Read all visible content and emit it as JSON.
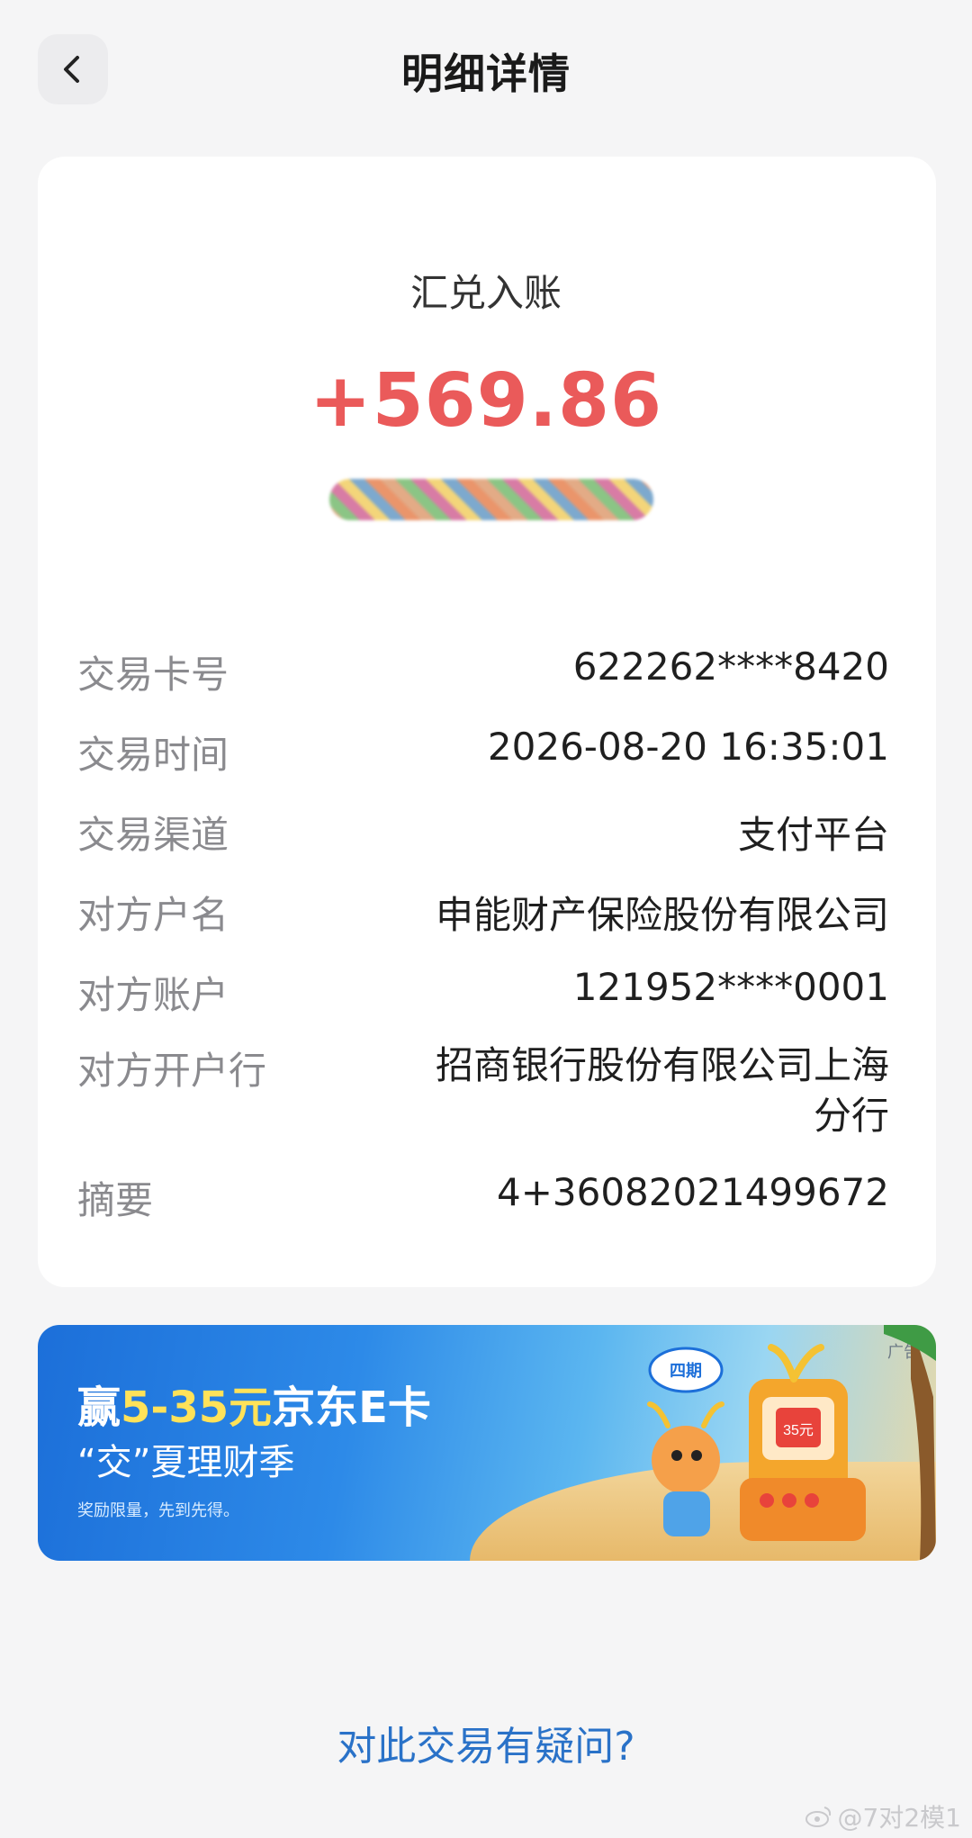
{
  "header": {
    "title": "明细详情",
    "back_icon": "chevron-left-icon"
  },
  "transaction": {
    "type": "汇兑入账",
    "amount": "+569.86",
    "amount_color": "#ea5a5a"
  },
  "details": [
    {
      "label": "交易卡号",
      "value": "622262****8420"
    },
    {
      "label": "交易时间",
      "value": "2026-08-20 16:35:01"
    },
    {
      "label": "交易渠道",
      "value": "支付平台"
    },
    {
      "label": "对方户名",
      "value": "申能财产保险股份有限公司"
    },
    {
      "label": "对方账户",
      "value": "121952****0001"
    },
    {
      "label": "对方开户行",
      "value": "招商银行股份有限公司上海分行"
    },
    {
      "label": "摘要",
      "value": "4+36082021499672"
    }
  ],
  "banner": {
    "headline_prefix": "赢",
    "headline_highlight": "5-35元",
    "headline_suffix": "京东E卡",
    "subtitle": "“交”夏理财季",
    "note": "奖励限量，先到先得。",
    "ad_tag": "广告",
    "badge": "四期",
    "envelope_amount": "35元"
  },
  "footer": {
    "question_link": "对此交易有疑问?"
  },
  "watermark": {
    "text": "@7对2模1",
    "icon": "weibo-icon"
  }
}
